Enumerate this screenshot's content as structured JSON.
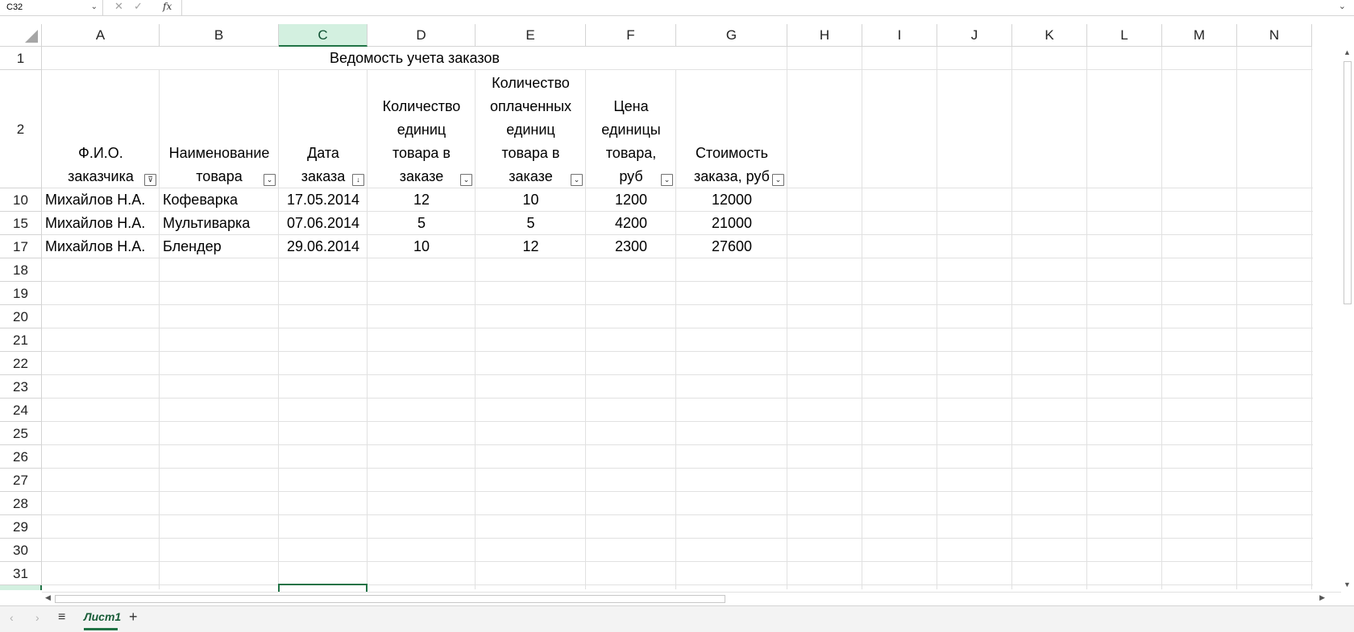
{
  "formula_bar": {
    "name_box": "C32",
    "fx_label": "fx",
    "formula": ""
  },
  "columns": [
    "A",
    "B",
    "C",
    "D",
    "E",
    "F",
    "G",
    "H",
    "I",
    "J",
    "K",
    "L",
    "M",
    "N"
  ],
  "selected_column": "C",
  "row_numbers": [
    "1",
    "2",
    "10",
    "15",
    "17",
    "18",
    "19",
    "20",
    "21",
    "22",
    "23",
    "24",
    "25",
    "26",
    "27",
    "28",
    "29",
    "30",
    "31"
  ],
  "sheet": {
    "title": "Ведомость учета заказов",
    "headers": [
      [
        "Ф.И.О.",
        "заказчика"
      ],
      [
        "Наименование",
        "товара"
      ],
      [
        "Дата",
        "заказа"
      ],
      [
        "Количество",
        "единиц",
        "товара в",
        "заказе"
      ],
      [
        "Количество",
        "оплаченных",
        "единиц",
        "товара в",
        "заказе"
      ],
      [
        "Цена",
        "единицы",
        "товара,",
        "руб"
      ],
      [
        "Стоимость",
        "заказа, руб"
      ]
    ],
    "rows": [
      [
        "Михайлов Н.А.",
        "Кофеварка",
        "17.05.2014",
        "12",
        "10",
        "1200",
        "12000"
      ],
      [
        "Михайлов Н.А.",
        "Мультиварка",
        "07.06.2014",
        "5",
        "5",
        "4200",
        "21000"
      ],
      [
        "Михайлов Н.А.",
        "Блендер",
        "29.06.2014",
        "10",
        "12",
        "2300",
        "27600"
      ]
    ]
  },
  "tabs": {
    "sheet1": "Лист1",
    "add": "+",
    "all_sheets": "≡"
  },
  "icons": {
    "cancel": "✕",
    "enter": "✓"
  },
  "accent_color": "#217346"
}
